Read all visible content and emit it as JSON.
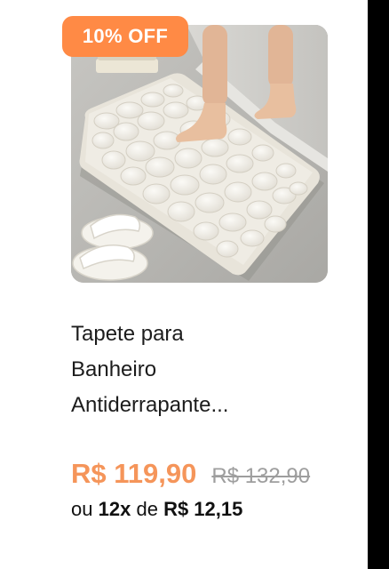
{
  "badge": {
    "label": "10% OFF",
    "color": "#ff8a45"
  },
  "product": {
    "image_icon": "bath-mat-product-photo",
    "title_lines": [
      "Tapete para",
      "Banheiro",
      "Antiderrapante..."
    ]
  },
  "pricing": {
    "current": "R$ 119,90",
    "original": "R$ 132,90",
    "current_color": "#f5955a",
    "installment": {
      "prefix": "ou",
      "count": "12x",
      "connector": "de",
      "amount": "R$ 12,15"
    }
  }
}
